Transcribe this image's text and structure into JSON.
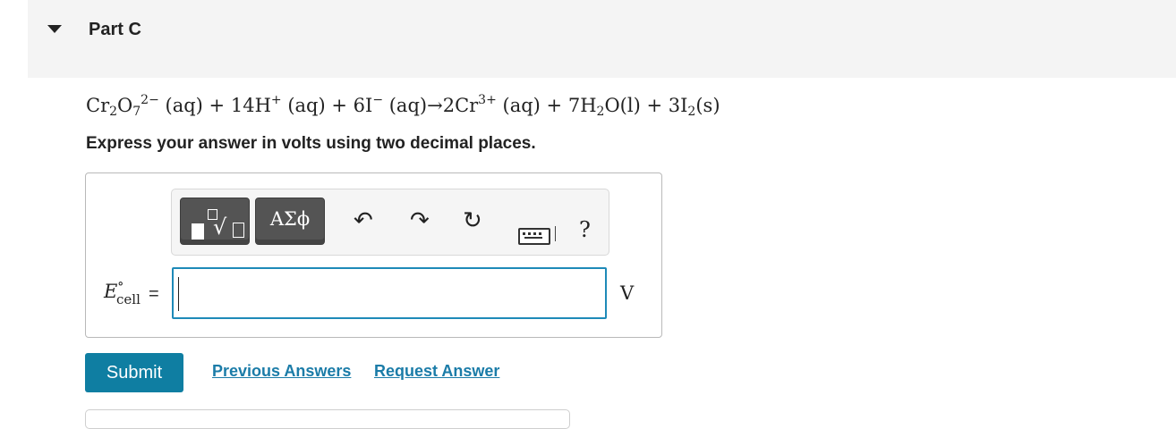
{
  "part": {
    "title": "Part C"
  },
  "equation": {
    "lhs1": {
      "el1": "Cr",
      "sub1": "2",
      "el2": "O",
      "sub2": "7",
      "charge": "2−",
      "state": "(aq)"
    },
    "plus1": "+",
    "lhs2": {
      "coef": "14H",
      "charge": "+",
      "state": "(aq)"
    },
    "plus2": "+",
    "lhs3": {
      "coef": "6I",
      "charge": "−",
      "state": "(aq)"
    },
    "arrow": "→",
    "rhs1": {
      "coef": "2Cr",
      "charge": "3+",
      "state": "(aq)"
    },
    "plus3": "+",
    "rhs2": {
      "coef": "7H",
      "sub": "2",
      "rest": "O",
      "state": "(l)"
    },
    "plus4": "+",
    "rhs3": {
      "coef": "3I",
      "sub": "2",
      "state": "(s)"
    }
  },
  "instruction": "Express your answer in volts using two decimal places.",
  "toolbar": {
    "templates_icon": "templates-icon",
    "symbols_label": "ΑΣϕ",
    "undo_icon": "undo-icon",
    "redo_icon": "redo-icon",
    "reset_icon": "reset-icon",
    "keyboard_icon": "keyboard-icon",
    "help_label": "?"
  },
  "answer": {
    "label_E": "E",
    "label_deg": "∘",
    "label_sub": "cell",
    "equals": "=",
    "value": "",
    "unit": "V"
  },
  "actions": {
    "submit": "Submit",
    "previous_answers": "Previous Answers",
    "request_answer": "Request Answer"
  },
  "colors": {
    "accent": "#0f7ea2",
    "link": "#1b7ca8",
    "input_border": "#1e8ab8",
    "toolbar_button": "#545454"
  }
}
